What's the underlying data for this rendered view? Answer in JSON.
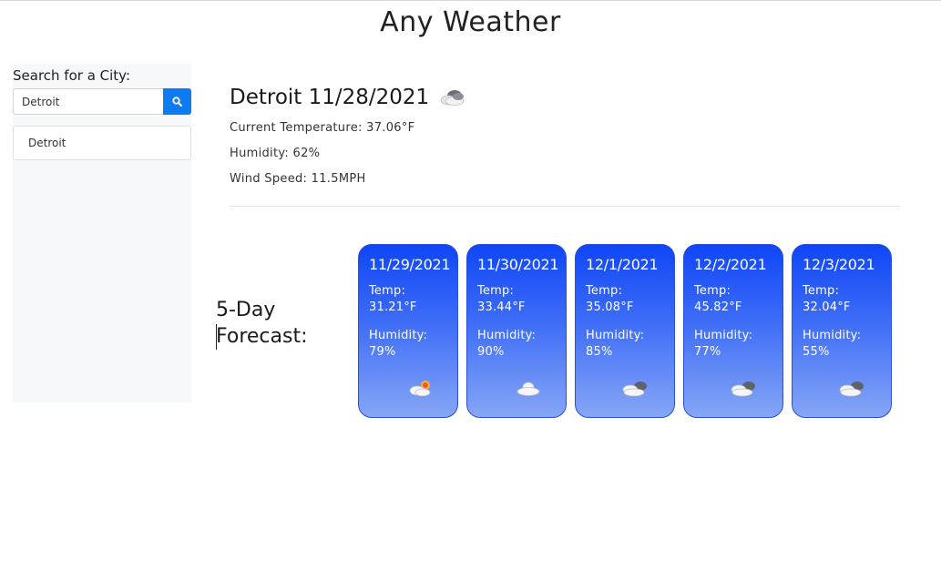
{
  "header": {
    "title": "Any Weather"
  },
  "search": {
    "label": "Search for a City:",
    "value": "Detroit",
    "button_icon": "search-icon"
  },
  "history": [
    "Detroit"
  ],
  "current": {
    "title": "Detroit 11/28/2021",
    "icon": "cloud-icon",
    "temperature": "Current Temperature: 37.06°F",
    "humidity": "Humidity: 62%",
    "wind": "Wind Speed: 11.5MPH"
  },
  "forecast": {
    "heading_line1": "5-Day",
    "heading_line2": "Forecast:",
    "days": [
      {
        "date": "11/29/2021",
        "temp_label": "Temp:",
        "temp": "31.21°F",
        "humidity_label": "Humidity:",
        "humidity": "79%",
        "icon": "sun-behind-cloud-icon"
      },
      {
        "date": "11/30/2021",
        "temp_label": "Temp:",
        "temp": "33.44°F",
        "humidity_label": "Humidity:",
        "humidity": "90%",
        "icon": "cloud-icon"
      },
      {
        "date": "12/1/2021",
        "temp_label": "Temp:",
        "temp": "35.08°F",
        "humidity_label": "Humidity:",
        "humidity": "85%",
        "icon": "broken-clouds-icon"
      },
      {
        "date": "12/2/2021",
        "temp_label": "Temp:",
        "temp": "45.82°F",
        "humidity_label": "Humidity:",
        "humidity": "77%",
        "icon": "broken-clouds-icon"
      },
      {
        "date": "12/3/2021",
        "temp_label": "Temp:",
        "temp": "32.04°F",
        "humidity_label": "Humidity:",
        "humidity": "55%",
        "icon": "broken-clouds-icon"
      }
    ]
  },
  "colors": {
    "search_button": "#0d7bf2",
    "card_top": "#0f46f7",
    "card_bottom": "#86a6f6",
    "sidebar_bg": "#f7f8fa"
  }
}
